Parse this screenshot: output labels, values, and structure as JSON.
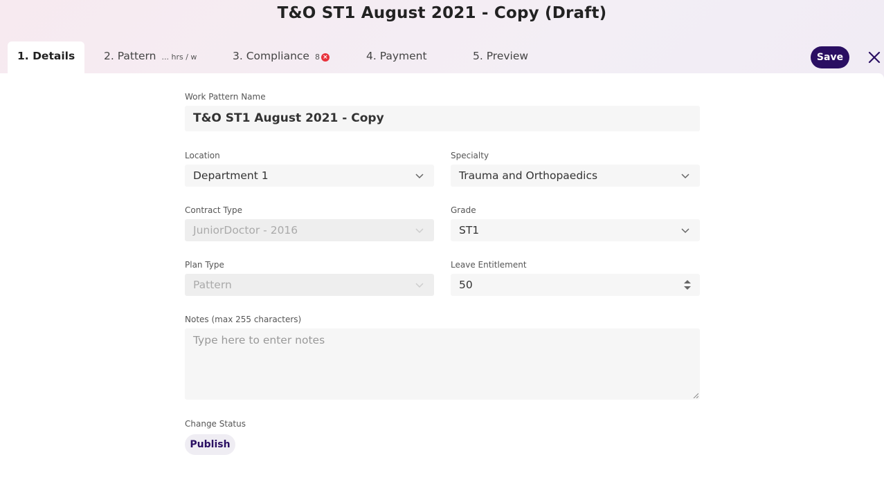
{
  "page": {
    "title": "T&O ST1 August 2021 - Copy (Draft)"
  },
  "tabs": [
    {
      "label": "1. Details"
    },
    {
      "label": "2. Pattern",
      "sub": "... hrs / w"
    },
    {
      "label": "3. Compliance",
      "count": "8"
    },
    {
      "label": "4. Payment"
    },
    {
      "label": "5. Preview"
    }
  ],
  "toolbar": {
    "save_label": "Save",
    "close_icon": "close-icon"
  },
  "form": {
    "work_pattern_name": {
      "label": "Work Pattern Name",
      "value": "T&O ST1 August 2021 - Copy"
    },
    "location": {
      "label": "Location",
      "value": "Department 1"
    },
    "specialty": {
      "label": "Specialty",
      "value": "Trauma and Orthopaedics"
    },
    "contract_type": {
      "label": "Contract Type",
      "value": "JuniorDoctor - 2016"
    },
    "grade": {
      "label": "Grade",
      "value": "ST1"
    },
    "plan_type": {
      "label": "Plan Type",
      "value": "Pattern"
    },
    "leave_entitlement": {
      "label": "Leave Entitlement",
      "value": "50"
    },
    "notes": {
      "label": "Notes (max 255 characters)",
      "placeholder": "Type here to enter notes"
    },
    "change_status": {
      "label": "Change Status",
      "publish_label": "Publish"
    }
  },
  "colors": {
    "accent": "#2a0f62",
    "error": "#e8323c"
  }
}
